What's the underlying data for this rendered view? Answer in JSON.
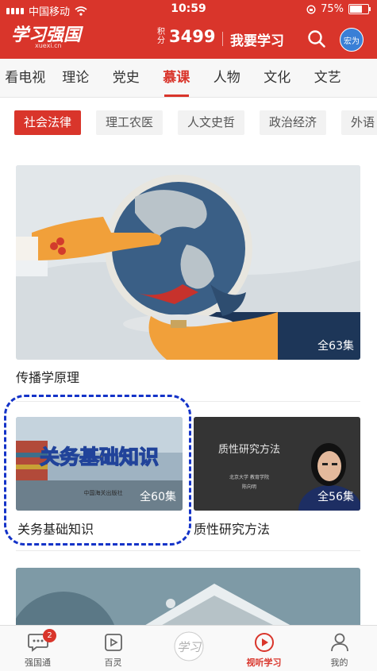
{
  "status_bar": {
    "carrier": "中国移动",
    "time": "10:59",
    "battery_pct": "75%",
    "battery_level": 0.75
  },
  "header": {
    "logo_text": "学习强国",
    "logo_sub": "xuexi.cn",
    "points_label_1": "积",
    "points_label_2": "分",
    "points_value": "3499",
    "study_link": "我要学习",
    "avatar_text": "宏为"
  },
  "nav_tabs": [
    {
      "label": "看电视"
    },
    {
      "label": "理论"
    },
    {
      "label": "党史"
    },
    {
      "label": "慕课"
    },
    {
      "label": "人物"
    },
    {
      "label": "文化"
    },
    {
      "label": "文艺"
    }
  ],
  "active_nav_tab": "慕课",
  "chips": [
    {
      "label": "社会法律"
    },
    {
      "label": "理工农医"
    },
    {
      "label": "人文史哲"
    },
    {
      "label": "政治经济"
    },
    {
      "label": "外语"
    }
  ],
  "courses": [
    {
      "title": "传播学原理",
      "count": "全63集"
    },
    {
      "title": "关务基础知识",
      "count": "全60集",
      "thumb_title": "关务基础知识",
      "thumb_publisher": "中国海关出版社"
    },
    {
      "title": "质性研究方法",
      "count": "全56集",
      "thumb_title": "质性研究方法",
      "thumb_sub": "北京大学 教育学院",
      "thumb_name": "陈向明"
    }
  ],
  "bottom_nav": [
    {
      "label": "强国通",
      "badge": "2"
    },
    {
      "label": "百灵"
    },
    {
      "label": "学习"
    },
    {
      "label": "视听学习"
    },
    {
      "label": "我的"
    }
  ],
  "colors": {
    "brand": "#d9352b",
    "highlight": "#1433c8"
  }
}
